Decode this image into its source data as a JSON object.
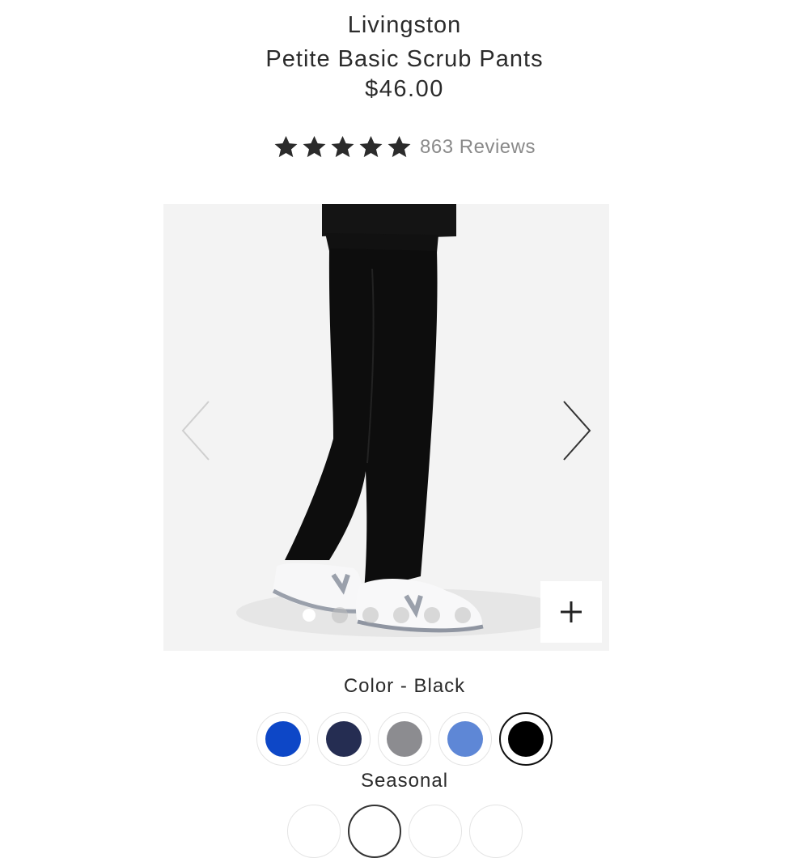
{
  "product": {
    "brand": "Livingston",
    "name": "Petite Basic Scrub Pants",
    "price": "$46.00"
  },
  "rating": {
    "stars": 5,
    "reviews_text": "863 Reviews"
  },
  "gallery": {
    "image_count": 6,
    "active_index": 0,
    "icons": {
      "prev": "chevron-left-icon",
      "next": "chevron-right-icon",
      "zoom": "plus-icon"
    }
  },
  "color": {
    "label": "Color - Black",
    "swatches": [
      {
        "name": "royal-blue",
        "hex": "#0d47c7"
      },
      {
        "name": "navy",
        "hex": "#252d52"
      },
      {
        "name": "gray",
        "hex": "#8c8c90"
      },
      {
        "name": "ceil-blue",
        "hex": "#5e87d6"
      },
      {
        "name": "black",
        "hex": "#000000",
        "selected": true
      }
    ],
    "seasonal_label": "Seasonal"
  }
}
